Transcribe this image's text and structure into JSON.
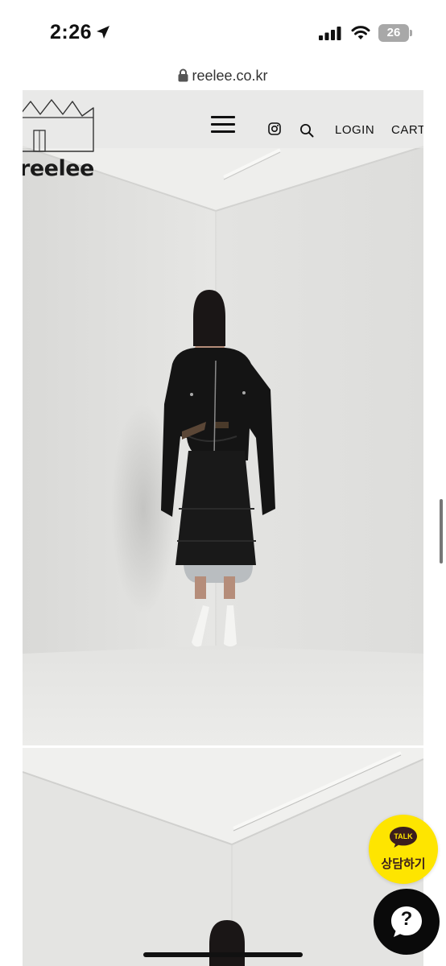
{
  "status_bar": {
    "time": "2:26",
    "battery": "26"
  },
  "browser": {
    "url": "reelee.co.kr"
  },
  "site": {
    "logo_text": "reelee",
    "nav": {
      "login": "LOGIN",
      "cart": "CART"
    }
  },
  "floating": {
    "kakao_badge": "TALK",
    "kakao_label": "상담하기",
    "help_symbol": "?"
  },
  "colors": {
    "kakao_yellow": "#fee500",
    "wall": "#e2e2e0"
  }
}
